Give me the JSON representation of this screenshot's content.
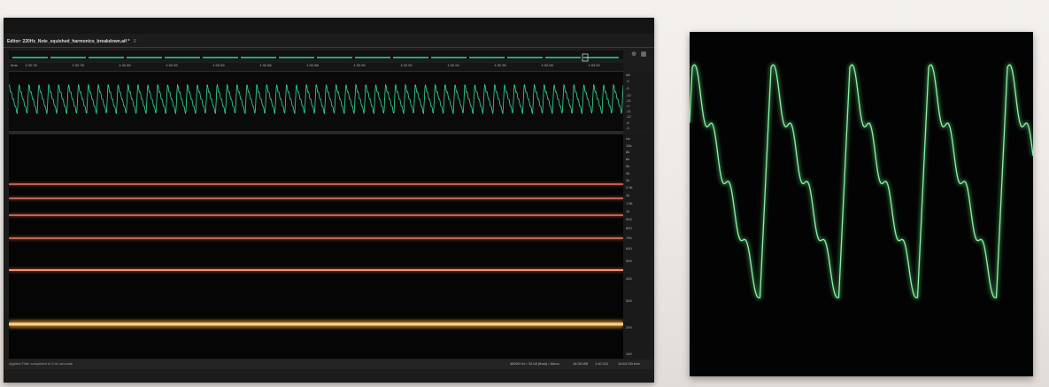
{
  "editor": {
    "tab_title": "Editor: 220Hz_Note_squished_harmonics_breakdown.aif *",
    "tab_menu_icon": "≡"
  },
  "icons": {
    "zoom": "zoom-icon",
    "settings": "grid-icon"
  },
  "time_ruler": {
    "unit": "hms",
    "ticks": [
      "1:32.76",
      "1:32.78",
      "1:32.80",
      "1:32.82",
      "1:32.84",
      "1:32.86",
      "1:32.88",
      "1:32.90",
      "1:32.92",
      "1:32.94",
      "1:32.96",
      "1:32.98",
      "1:33.00"
    ]
  },
  "waveform_scale": {
    "labels": [
      "dB",
      "-3",
      "-6",
      "-12",
      "-21",
      "-∞",
      "-21",
      "-12",
      "-6",
      "-3"
    ]
  },
  "frequency_scale": {
    "labels": [
      "Hz",
      "10k",
      "8k",
      "6k",
      "5k",
      "4k",
      "3k",
      "2.5k",
      "2k",
      "1.5k",
      "1k",
      "900",
      "800",
      "700",
      "600",
      "500",
      "400",
      "300",
      "200",
      "100"
    ]
  },
  "status": {
    "message": "Applied Filter completed in 0.01 seconds",
    "format": "48000 Hz • 32-bit (float) • Mono",
    "size": "18.38 MB",
    "duration": "1:40.311",
    "free": "14.63 GB free"
  },
  "colors": {
    "waveform": "#2fd9a4",
    "harmonic_line": "#ff6a4d",
    "fundamental_line": "#ffb347",
    "scope_trace": "#59e07a"
  },
  "harmonic_lines": [
    {
      "name": "harmonic-6",
      "frequency_hz": 1320,
      "intensity": 0.55
    },
    {
      "name": "harmonic-5",
      "frequency_hz": 1100,
      "intensity": 0.6
    },
    {
      "name": "harmonic-4",
      "frequency_hz": 880,
      "intensity": 0.65
    },
    {
      "name": "harmonic-3",
      "frequency_hz": 660,
      "intensity": 0.7
    },
    {
      "name": "harmonic-2",
      "frequency_hz": 440,
      "intensity": 0.85
    },
    {
      "name": "fundamental",
      "frequency_hz": 220,
      "intensity": 1.0
    }
  ]
}
